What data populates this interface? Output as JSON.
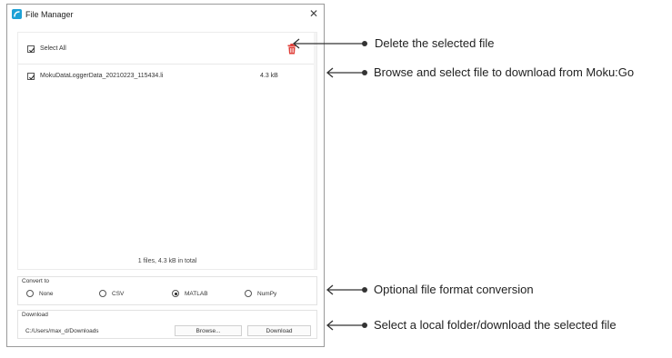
{
  "window": {
    "title": "File Manager",
    "close_glyph": "✕"
  },
  "file_list": {
    "select_all_label": "Select All",
    "files": [
      {
        "name": "MokuDataLoggerData_20210223_115434.li",
        "size": "4.3 kB",
        "checked": true
      }
    ],
    "summary": "1 files, 4.3 kB in total"
  },
  "convert": {
    "label": "Convert to",
    "options": [
      "None",
      "CSV",
      "MATLAB",
      "NumPy"
    ],
    "selected": "MATLAB"
  },
  "download": {
    "label": "Download",
    "path": "C:/Users/max_d/Downloads",
    "browse_label": "Browse...",
    "download_label": "Download"
  },
  "callouts": [
    "Delete the selected file",
    "Browse and select file to download from Moku:Go",
    "Optional file format conversion",
    "Select a local folder/download the selected file"
  ],
  "colors": {
    "app_icon": "#1da1d6",
    "trash": "#e0403a",
    "callout_line": "#333333"
  },
  "icons": {
    "app": "moku-app-icon",
    "close": "close-icon",
    "trash": "trash-icon",
    "checkbox": "check-icon"
  }
}
